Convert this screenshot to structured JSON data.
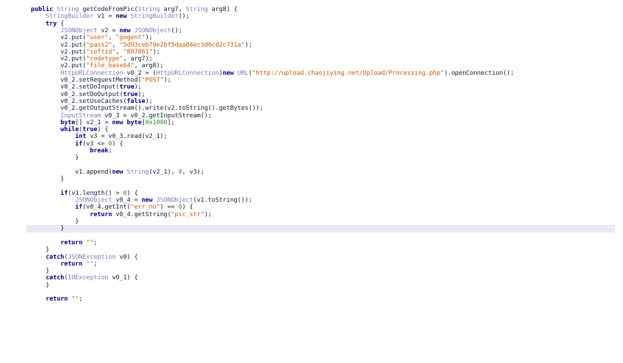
{
  "editor": {
    "lines": [
      [
        {
          "t": "public",
          "c": "kw"
        },
        {
          "t": " "
        },
        {
          "t": "String",
          "c": "ty"
        },
        {
          "t": " getCodeFromPic("
        },
        {
          "t": "String",
          "c": "ty"
        },
        {
          "t": " arg7, "
        },
        {
          "t": "String",
          "c": "ty"
        },
        {
          "t": " arg8) {"
        }
      ],
      [
        {
          "t": "    "
        },
        {
          "t": "StringBuilder",
          "c": "ty"
        },
        {
          "t": " v1 = "
        },
        {
          "t": "new",
          "c": "kw"
        },
        {
          "t": " "
        },
        {
          "t": "StringBuilder",
          "c": "ty"
        },
        {
          "t": "();"
        }
      ],
      [
        {
          "t": "    "
        },
        {
          "t": "try",
          "c": "kw"
        },
        {
          "t": " {"
        }
      ],
      [
        {
          "t": "        "
        },
        {
          "t": "JSONObject",
          "c": "ty"
        },
        {
          "t": " v2 = "
        },
        {
          "t": "new",
          "c": "kw"
        },
        {
          "t": " "
        },
        {
          "t": "JSONObject",
          "c": "ty"
        },
        {
          "t": "();"
        }
      ],
      [
        {
          "t": "        v2.put("
        },
        {
          "t": "\"user\"",
          "c": "st"
        },
        {
          "t": ", "
        },
        {
          "t": "\"gogent\"",
          "c": "st"
        },
        {
          "t": ");"
        }
      ],
      [
        {
          "t": "        v2.put("
        },
        {
          "t": "\"pass2\"",
          "c": "st"
        },
        {
          "t": ", "
        },
        {
          "t": "\"5d93ceb70e2bf5daa84ec3d0cd2c731a\"",
          "c": "st"
        },
        {
          "t": ");"
        }
      ],
      [
        {
          "t": "        v2.put("
        },
        {
          "t": "\"softid\"",
          "c": "st"
        },
        {
          "t": ", "
        },
        {
          "t": "\"897061\"",
          "c": "st"
        },
        {
          "t": ");"
        }
      ],
      [
        {
          "t": "        v2.put("
        },
        {
          "t": "\"codetype\"",
          "c": "st"
        },
        {
          "t": ", arg7);"
        }
      ],
      [
        {
          "t": "        v2.put("
        },
        {
          "t": "\"file_base64\"",
          "c": "st"
        },
        {
          "t": ", arg8);"
        }
      ],
      [
        {
          "t": "        "
        },
        {
          "t": "HttpURLConnection",
          "c": "ty"
        },
        {
          "t": " v0_2 = ("
        },
        {
          "t": "HttpURLConnection",
          "c": "ty"
        },
        {
          "t": ")"
        },
        {
          "t": "new",
          "c": "kw"
        },
        {
          "t": " "
        },
        {
          "t": "URL",
          "c": "ty"
        },
        {
          "t": "("
        },
        {
          "t": "\"http://upload.chaojiying.net/Upload/Processing.php\"",
          "c": "st"
        },
        {
          "t": ").openConnection();"
        }
      ],
      [
        {
          "t": "        v0_2.setRequestMethod("
        },
        {
          "t": "\"POST\"",
          "c": "st"
        },
        {
          "t": ");"
        }
      ],
      [
        {
          "t": "        v0_2.setDoInput("
        },
        {
          "t": "true",
          "c": "kw"
        },
        {
          "t": ");"
        }
      ],
      [
        {
          "t": "        v0_2.setDoOutput("
        },
        {
          "t": "true",
          "c": "kw"
        },
        {
          "t": ");"
        }
      ],
      [
        {
          "t": "        v0_2.setUseCaches("
        },
        {
          "t": "false",
          "c": "kw"
        },
        {
          "t": ");"
        }
      ],
      [
        {
          "t": "        v0_2.getOutputStream().write(v2.toString().getBytes());"
        }
      ],
      [
        {
          "t": "        "
        },
        {
          "t": "InputStream",
          "c": "ty"
        },
        {
          "t": " v0_3 = v0_2.getInputStream();"
        }
      ],
      [
        {
          "t": "        "
        },
        {
          "t": "byte",
          "c": "kw"
        },
        {
          "t": "[] v2_1 = "
        },
        {
          "t": "new",
          "c": "kw"
        },
        {
          "t": " "
        },
        {
          "t": "byte",
          "c": "kw"
        },
        {
          "t": "["
        },
        {
          "t": "0x1000",
          "c": "nu"
        },
        {
          "t": "];"
        }
      ],
      [
        {
          "t": "        "
        },
        {
          "t": "while",
          "c": "kw"
        },
        {
          "t": "("
        },
        {
          "t": "true",
          "c": "kw"
        },
        {
          "t": ") {"
        }
      ],
      [
        {
          "t": "            "
        },
        {
          "t": "int",
          "c": "kw"
        },
        {
          "t": " v3 = v0_3.read(v2_1);"
        }
      ],
      [
        {
          "t": "            "
        },
        {
          "t": "if",
          "c": "kw"
        },
        {
          "t": "(v3 <= "
        },
        {
          "t": "0",
          "c": "nu"
        },
        {
          "t": ") {"
        }
      ],
      [
        {
          "t": "                "
        },
        {
          "t": "break",
          "c": "kw"
        },
        {
          "t": ";"
        }
      ],
      [
        {
          "t": "            }"
        }
      ],
      [],
      [
        {
          "t": "            v1.append("
        },
        {
          "t": "new",
          "c": "kw"
        },
        {
          "t": " "
        },
        {
          "t": "String",
          "c": "ty"
        },
        {
          "t": "(v2_1), "
        },
        {
          "t": "0",
          "c": "nu"
        },
        {
          "t": ", v3);"
        }
      ],
      [
        {
          "t": "        }"
        }
      ],
      [],
      [
        {
          "t": "        "
        },
        {
          "t": "if",
          "c": "kw"
        },
        {
          "t": "(v1.length() > "
        },
        {
          "t": "0",
          "c": "nu"
        },
        {
          "t": ") {"
        }
      ],
      [
        {
          "t": "            "
        },
        {
          "t": "JSONObject",
          "c": "ty"
        },
        {
          "t": " v0_4 = "
        },
        {
          "t": "new",
          "c": "kw"
        },
        {
          "t": " "
        },
        {
          "t": "JSONObject",
          "c": "ty"
        },
        {
          "t": "(v1.toString());"
        }
      ],
      [
        {
          "t": "            "
        },
        {
          "t": "if",
          "c": "kw"
        },
        {
          "t": "(v0_4.getInt("
        },
        {
          "t": "\"err_no\"",
          "c": "st"
        },
        {
          "t": ") == "
        },
        {
          "t": "0",
          "c": "nu"
        },
        {
          "t": ") {"
        }
      ],
      [
        {
          "t": "                "
        },
        {
          "t": "return",
          "c": "kw"
        },
        {
          "t": " v0_4.getString("
        },
        {
          "t": "\"pic_str\"",
          "c": "st"
        },
        {
          "t": ");"
        }
      ],
      [
        {
          "t": "            }"
        }
      ],
      [
        {
          "t": "        }"
        }
      ],
      [],
      [
        {
          "t": "        "
        },
        {
          "t": "return",
          "c": "kw"
        },
        {
          "t": " "
        },
        {
          "t": "\"\"",
          "c": "st"
        },
        {
          "t": ";"
        }
      ],
      [
        {
          "t": "    }"
        }
      ],
      [
        {
          "t": "    "
        },
        {
          "t": "catch",
          "c": "kw"
        },
        {
          "t": "("
        },
        {
          "t": "JSONException",
          "c": "ty"
        },
        {
          "t": " v0) {"
        }
      ],
      [
        {
          "t": "        "
        },
        {
          "t": "return",
          "c": "kw"
        },
        {
          "t": " "
        },
        {
          "t": "\"\"",
          "c": "st"
        },
        {
          "t": ";"
        }
      ],
      [
        {
          "t": "    }"
        }
      ],
      [
        {
          "t": "    "
        },
        {
          "t": "catch",
          "c": "kw"
        },
        {
          "t": "("
        },
        {
          "t": "IOException",
          "c": "ty"
        },
        {
          "t": " v0_1) {"
        }
      ],
      [
        {
          "t": "    }"
        }
      ],
      [],
      [
        {
          "t": "    "
        },
        {
          "t": "return",
          "c": "kw"
        },
        {
          "t": " "
        },
        {
          "t": "\"\"",
          "c": "st"
        },
        {
          "t": ";"
        }
      ]
    ]
  }
}
